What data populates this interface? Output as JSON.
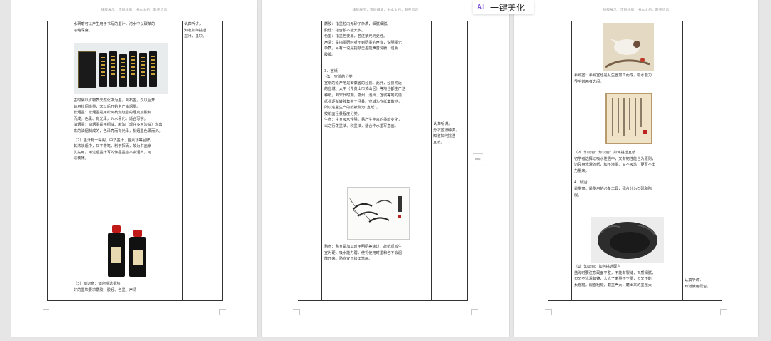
{
  "header": "排版展示，页码排版，书本文档，题卷信息",
  "toolbar": {
    "ai_icon": "AI",
    "ai_label": "一键美化",
    "add_page_glyph": "+"
  },
  "page1": {
    "col2": [
      "水研磨可以产生用于书写的墨汁，溶水中以碳单的",
      "浓缩深度。",
      "古时候以矿物质天然化做为墨，叫石墨。汉以后开",
      "始用松烟造墨，宋以后开始生产油烟墨。",
      "松烟墨：松烟墨是用松树枝燃烧后的烟炱加胶制",
      "而成。色黑、有光泽，入水易化，适合写字。",
      "油烟墨：油烟墨是用桐油、麻油（现在多用漆油）燃出",
      "来的油烟制成的，色泽亮而有光泽，松烟墨色黑而沉。",
      "（2）墨汁有一得阁、中华墨汁、曹素功等品牌。",
      "其浓淡适中，又不滞笔，利于挥洒，故为书画家",
      "优先用。用过后墨汁写的作品墨迹不会洇出，可",
      "以装裱。",
      "（3）知识窗：如何挑选墨块",
      "好的墨块要求麝胶、胶轻、色墨、声清"
    ],
    "col3": [
      "认真听讲，",
      "知道如何挑选",
      "墨汁、墨块。"
    ]
  },
  "page2": {
    "col2": [
      "麝胶：指墨粒内无砂子杂质，细腻细腻。",
      "胶轻：指含胶不能太多。",
      "色墨：指墨色要黑，若还紫光则更佳。",
      "声清：是指墨研时听不到研墨的声音，说明墨无",
      "杂质。另有一说是指敲击墨能声音清脆，说明",
      "胶细。",
      "3．宣纸",
      "（1）宣纸的分类",
      "宣纸的原产地是安徽省的泾县。此外，泾县附近",
      "的宣城、太平（今黄山市黄山区）等地也都生产这",
      "种纸。到宋代时期，徽州、池州、宣城等地的造",
      "纸业逐渐转移集中于泾县。宣城为宣纸集散地，",
      "所以这些生产的纸被称为“宣纸”。",
      "按纸面泾县程度分类。",
      "生宣：生宣吸水性强，易产生丰富的墨韵变化，",
      "以之行泼墨法、积墨法，适合作水墨写意画。",
      "熟宣：熟宣是加工时用明矾等涂过，故纸质较生",
      "宣为硬，吸水能力弱，使得使用时墨和色不会洇",
      "散开来。熟宣宜于绘工笔画。"
    ],
    "col3": [
      "认真听讲，",
      "分析宣纸种类，",
      "知道如何挑选",
      "宣纸。"
    ]
  },
  "page3": {
    "col2": [
      "半熟宣：半熟宣也是从生宣加工而成，吸水能力",
      "界乎前两者之间。",
      "（2）知识窗：知识窗：如何挑选宣纸",
      "初学者选择以吸水性强中，又有韧性能合为原则，",
      "切忌用光滑的纸，和不渗墨、又不吸笔，更写不出",
      "力量来。",
      "4．砚台",
      "是墨窗。是墨用的必备工具，砚台分为石砚和陶",
      "砚。",
      "（1）知识窗：如何挑选砚台",
      "选购时要注意砚面平整，不能有裂缝，石质细腻，",
      "但又不光滑如镜，太光了磨墨不下墨，但又不能",
      "太粗糙，砚面粗糙，磨墨声大，磨出来的墨粗大"
    ],
    "col3": [
      "认真听讲，",
      "知道使用砚台。"
    ]
  }
}
